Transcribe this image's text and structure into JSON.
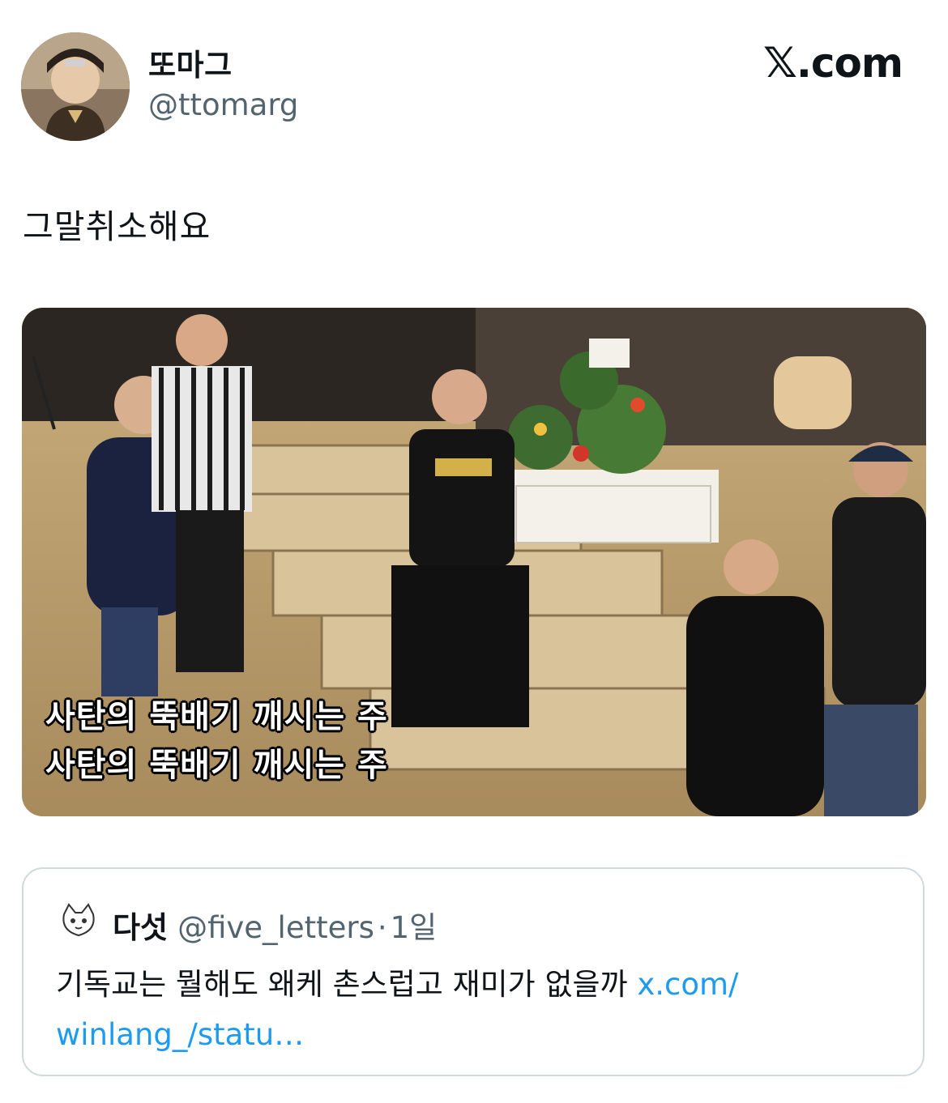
{
  "author": {
    "display_name": "또마그",
    "handle": "@ttomarg"
  },
  "brand": {
    "x_glyph": "𝕏",
    "domain_suffix": ".com"
  },
  "tweet": {
    "text": "그말취소해요"
  },
  "media": {
    "icon": "video-still-image",
    "subtitle_line1": "사탄의 뚝배기 깨시는 주",
    "subtitle_line2": "사탄의 뚝배기 깨시는 주"
  },
  "quote": {
    "display_name": "다섯",
    "handle": "@five_letters",
    "separator": "·",
    "time": "1일",
    "text": "기독교는 뭘해도 왜케 촌스럽고 재미가 없을까 ",
    "link_part1": "x.com/",
    "link_part2": "winlang_/statu…"
  },
  "colors": {
    "text": "#0f1419",
    "secondary": "#536471",
    "link": "#1d9bf0",
    "border": "#cfd9de"
  }
}
